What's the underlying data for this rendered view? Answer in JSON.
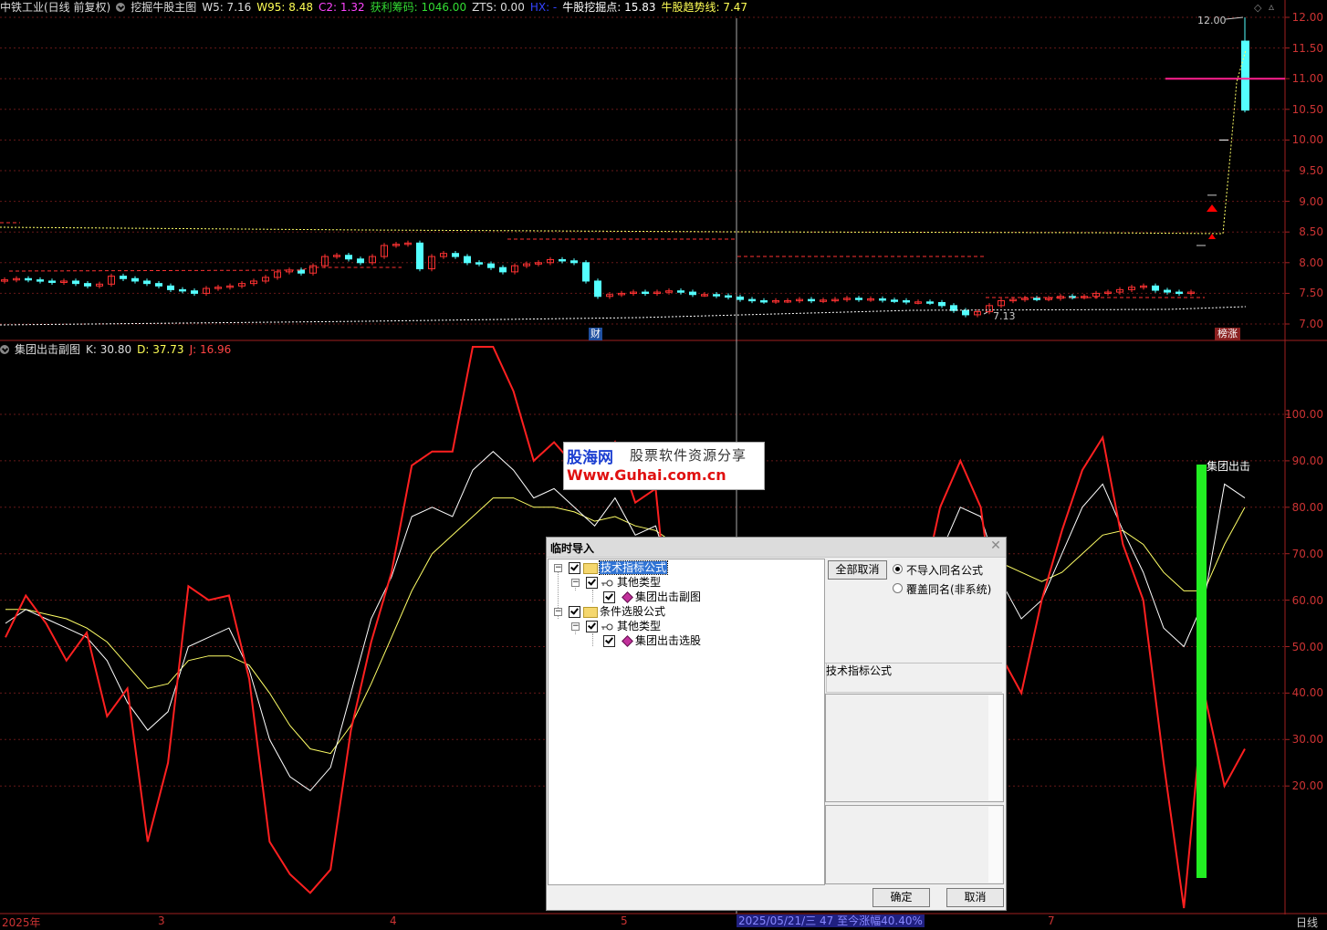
{
  "top_header": {
    "stock": "中铁工业(日线 前复权)",
    "indicator": "挖掘牛股主图",
    "w5": "W5: 7.16",
    "w95": "W95: 8.48",
    "c2": "C2: 1.32",
    "profit_chips": "获利筹码: 1046.00",
    "zts": "ZTS: 0.00",
    "hx": "HX: -",
    "dig_point": "牛股挖掘点: 15.83",
    "trend_line": "牛股趋势线: 7.47"
  },
  "sub_header": {
    "indicator": "集团出击副图",
    "k": "K: 30.80",
    "d": "D: 37.73",
    "j": "J: 16.96"
  },
  "main_chart_labels": {
    "high_label": "12.00",
    "low_label": "7.13",
    "cai_badge": "财",
    "bang_badge": "榜涨"
  },
  "sub_chart_labels": {
    "signal_label": "集团出击"
  },
  "price_axis": [
    "12.00",
    "11.50",
    "11.00",
    "10.50",
    "10.00",
    "9.50",
    "9.00",
    "8.50",
    "8.00",
    "7.50",
    "7.00"
  ],
  "osc_axis": [
    "100.00",
    "90.00",
    "80.00",
    "70.00",
    "60.00",
    "50.00",
    "40.00",
    "30.00",
    "20.00"
  ],
  "time_axis": {
    "labels": [
      "2025年",
      "3",
      "4",
      "5",
      "7"
    ],
    "cursor_info": "2025/05/21/三 47 至今涨幅40.40%",
    "period": "日线"
  },
  "watermark": {
    "site": "股海网",
    "slogan": "股票软件资源分享",
    "url": "Www.Guhai.com.cn"
  },
  "dialog": {
    "title": "临时导入",
    "tree": {
      "n1": "技术指标公式",
      "n1a": "其他类型",
      "n1a1": "集团出击副图",
      "n2": "条件选股公式",
      "n2a": "其他类型",
      "n2a1": "集团出击选股"
    },
    "btn_uncheck_all": "全部取消",
    "radio_skip": "不导入同名公式",
    "radio_overwrite": "覆盖同名(非系统)",
    "section_label": "技术指标公式",
    "ok": "确定",
    "cancel": "取消"
  },
  "colors": {
    "up": "#ff3232",
    "down": "#54ffff",
    "k_line": "#ffffff",
    "d_line": "#ffff66",
    "j_line": "#ff2020",
    "signal_bar": "#22ee22",
    "selection": "#3174d4"
  }
}
